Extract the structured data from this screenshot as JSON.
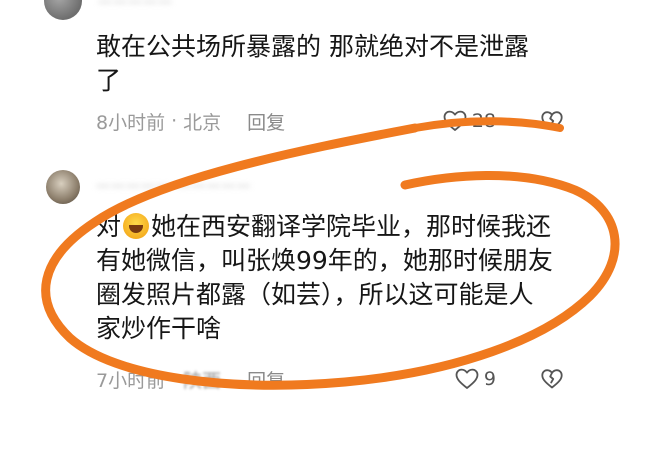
{
  "comments": [
    {
      "username": "—————",
      "text": "敢在公共场所暴露的  那就绝对不是泄露\n了",
      "time": "8小时前",
      "separator": "·",
      "location": "北京",
      "reply": "回复",
      "likes": "28"
    },
    {
      "username": "————— —————",
      "text_before_emoji": "对",
      "emoji": "laughing-crying-emoji",
      "text_after_emoji": "她在西安翻译学院毕业，那时候我还\n有她微信，叫张焕99年的，她那时候朋友\n圈发照片都露（如芸），所以这可能是人\n家炒作干啥",
      "time": "7小时前",
      "separator": "·",
      "location": "陕西",
      "reply": "回复",
      "likes": "9"
    }
  ],
  "icons": {
    "like": "heart-outline-icon",
    "dislike": "broken-heart-icon"
  },
  "colors": {
    "annotation": "#f07a1f",
    "meta_text": "#9a9a9a",
    "body_text": "#161616"
  }
}
